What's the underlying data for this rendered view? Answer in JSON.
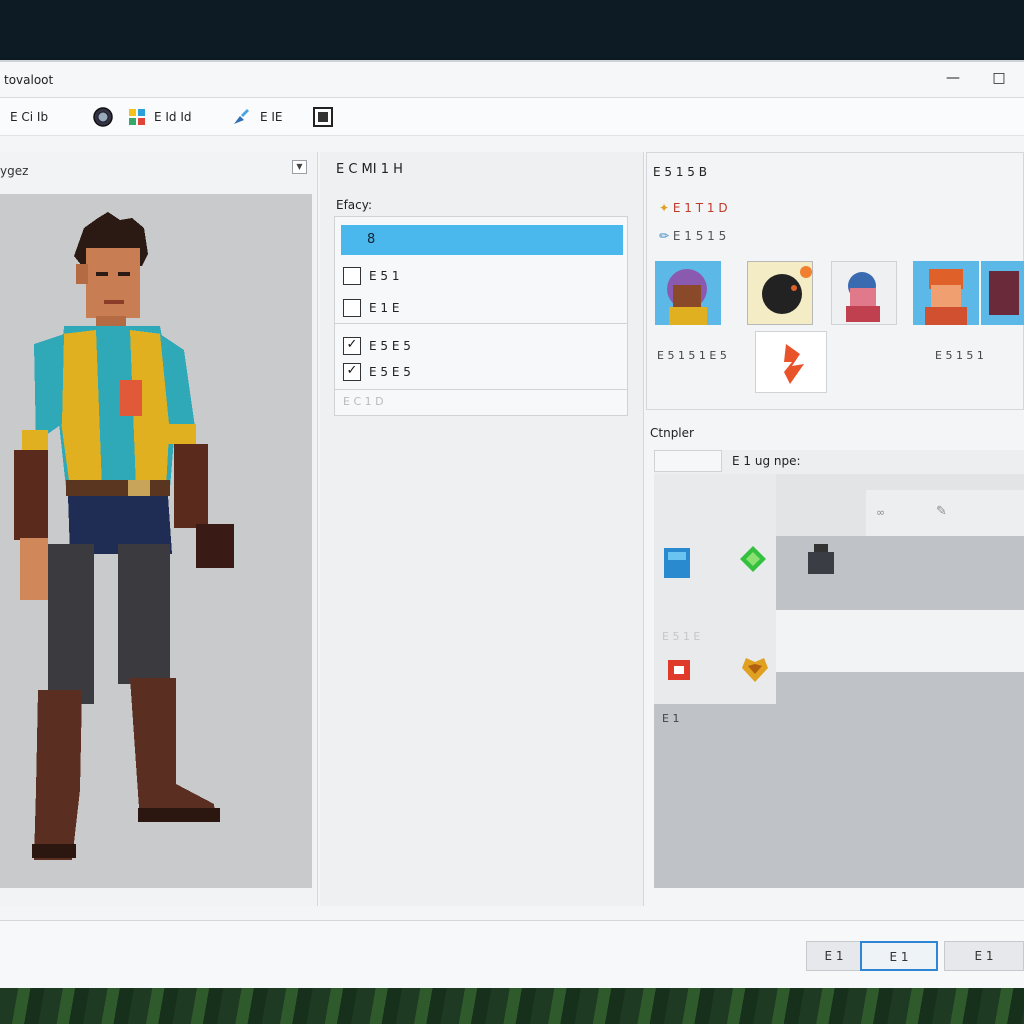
{
  "window": {
    "title": "tovaloot"
  },
  "toolbar": {
    "item1": "E Ci Ib",
    "item2": "E Id Id",
    "item3": "E IE",
    "icons": [
      "globe-icon",
      "color-icon",
      "brush-icon",
      "image-icon"
    ]
  },
  "preview_panel": {
    "title": "ygez"
  },
  "options_panel": {
    "title": "E C MI 1 H",
    "label": "Efacy:",
    "selected_item": "8",
    "items": [
      {
        "label": "E 5 1",
        "checked": false
      },
      {
        "label": "E 1 E",
        "checked": false
      },
      {
        "label": "E 5 E 5",
        "checked": true
      },
      {
        "label": "E 5 E 5",
        "checked": true
      }
    ],
    "ghost_label": "E C 1 D"
  },
  "portraits_panel": {
    "title": "E 5 1 5 B",
    "options": [
      "E 1 T 1 D",
      "E 1 5 1 5"
    ],
    "caption_left": "E 5 1 5 1 E 5",
    "caption_right": "E 5 1 5 1"
  },
  "component_panel": {
    "label": "Ctnpler",
    "tab_active": "",
    "tab_label": "E 1 ug npe:",
    "row_label": "E 5 1 E",
    "footer_label": "E 1",
    "side_icons": [
      "chain-icon",
      "pencil-icon"
    ]
  },
  "footer": {
    "buttons": [
      "E 1",
      "E 1",
      "E 1"
    ]
  }
}
